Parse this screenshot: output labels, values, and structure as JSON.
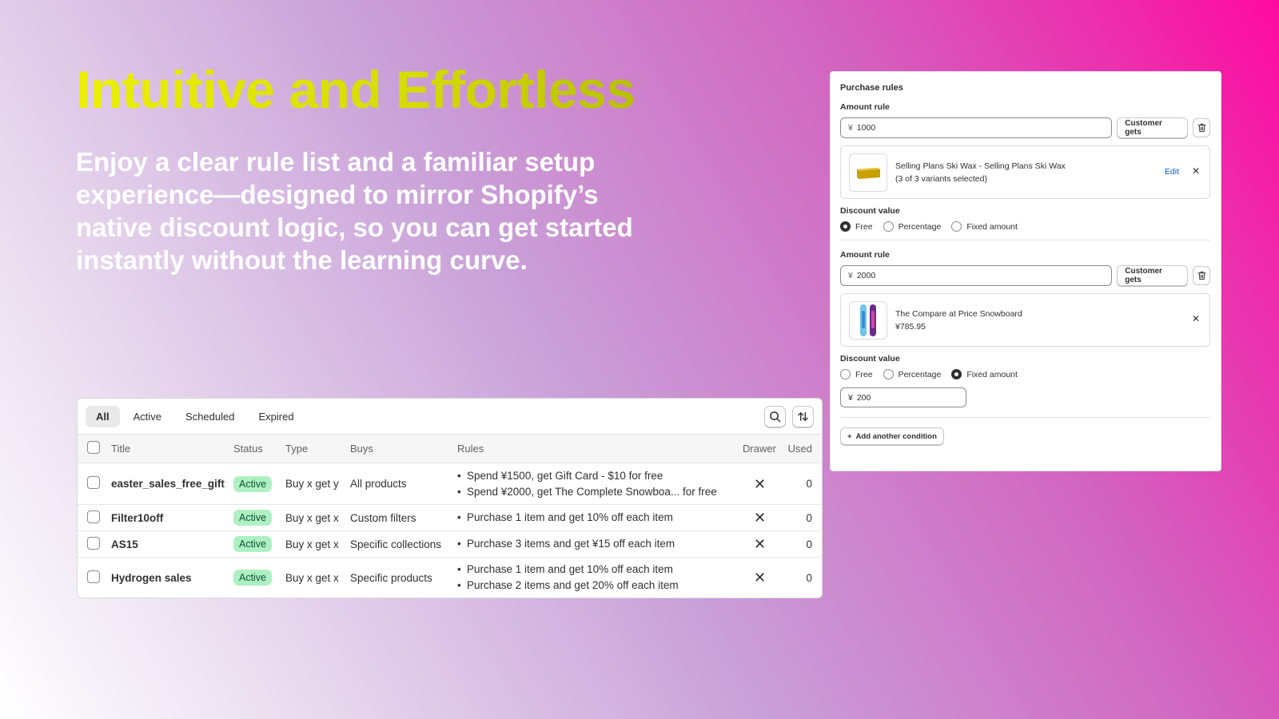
{
  "hero": {
    "title": "Intuitive and Effortless",
    "subtitle": "Enjoy a clear rule list and a familiar setup experience—designed to mirror Shopify’s native discount logic, so you can get started instantly without the learning curve."
  },
  "discount_list": {
    "tabs": [
      {
        "label": "All",
        "selected": true
      },
      {
        "label": "Active",
        "selected": false
      },
      {
        "label": "Scheduled",
        "selected": false
      },
      {
        "label": "Expired",
        "selected": false
      }
    ],
    "columns": [
      "Title",
      "Status",
      "Type",
      "Buys",
      "Rules",
      "Drawer",
      "Used"
    ],
    "rows": [
      {
        "title": "easter_sales_free_gift",
        "status": "Active",
        "type": "Buy x get y",
        "buys": "All products",
        "rules": [
          "Spend ¥1500, get Gift Card - $10 for free",
          "Spend ¥2000, get The Complete Snowboa... for free"
        ],
        "used": "0"
      },
      {
        "title": "Filter10off",
        "status": "Active",
        "type": "Buy x get x",
        "buys": "Custom filters",
        "rules": [
          "Purchase 1 item and get 10% off each item"
        ],
        "used": "0"
      },
      {
        "title": "AS15",
        "status": "Active",
        "type": "Buy x get x",
        "buys": "Specific collections",
        "rules": [
          "Purchase 3 items and get ¥15 off each item"
        ],
        "used": "0"
      },
      {
        "title": "Hydrogen sales",
        "status": "Active",
        "type": "Buy x get x",
        "buys": "Specific products",
        "rules": [
          "Purchase 1 item and get 10% off each item",
          "Purchase 2 items and get 20% off each item"
        ],
        "used": "0"
      }
    ],
    "colors": {
      "badge_bg": "#aff0c3",
      "badge_text": "#0c5132"
    }
  },
  "purchase_rules": {
    "title": "Purchase rules",
    "amount_label": "Amount rule",
    "currency": "¥",
    "customer_gets_label": "Customer gets",
    "discount_value_label": "Discount value",
    "radio_labels": {
      "free": "Free",
      "percentage": "Percentage",
      "fixed": "Fixed amount"
    },
    "rule1": {
      "amount": "1000",
      "product_name": "Selling Plans Ski Wax - Selling Plans Ski Wax",
      "product_detail": "(3 of 3 variants selected)",
      "edit_label": "Edit",
      "selected": "free"
    },
    "rule2": {
      "amount": "2000",
      "product_name": "The Compare at Price Snowboard",
      "product_detail": "¥785.95",
      "selected": "fixed",
      "fixed_value": "200"
    },
    "add_condition_label": "Add another condition"
  }
}
